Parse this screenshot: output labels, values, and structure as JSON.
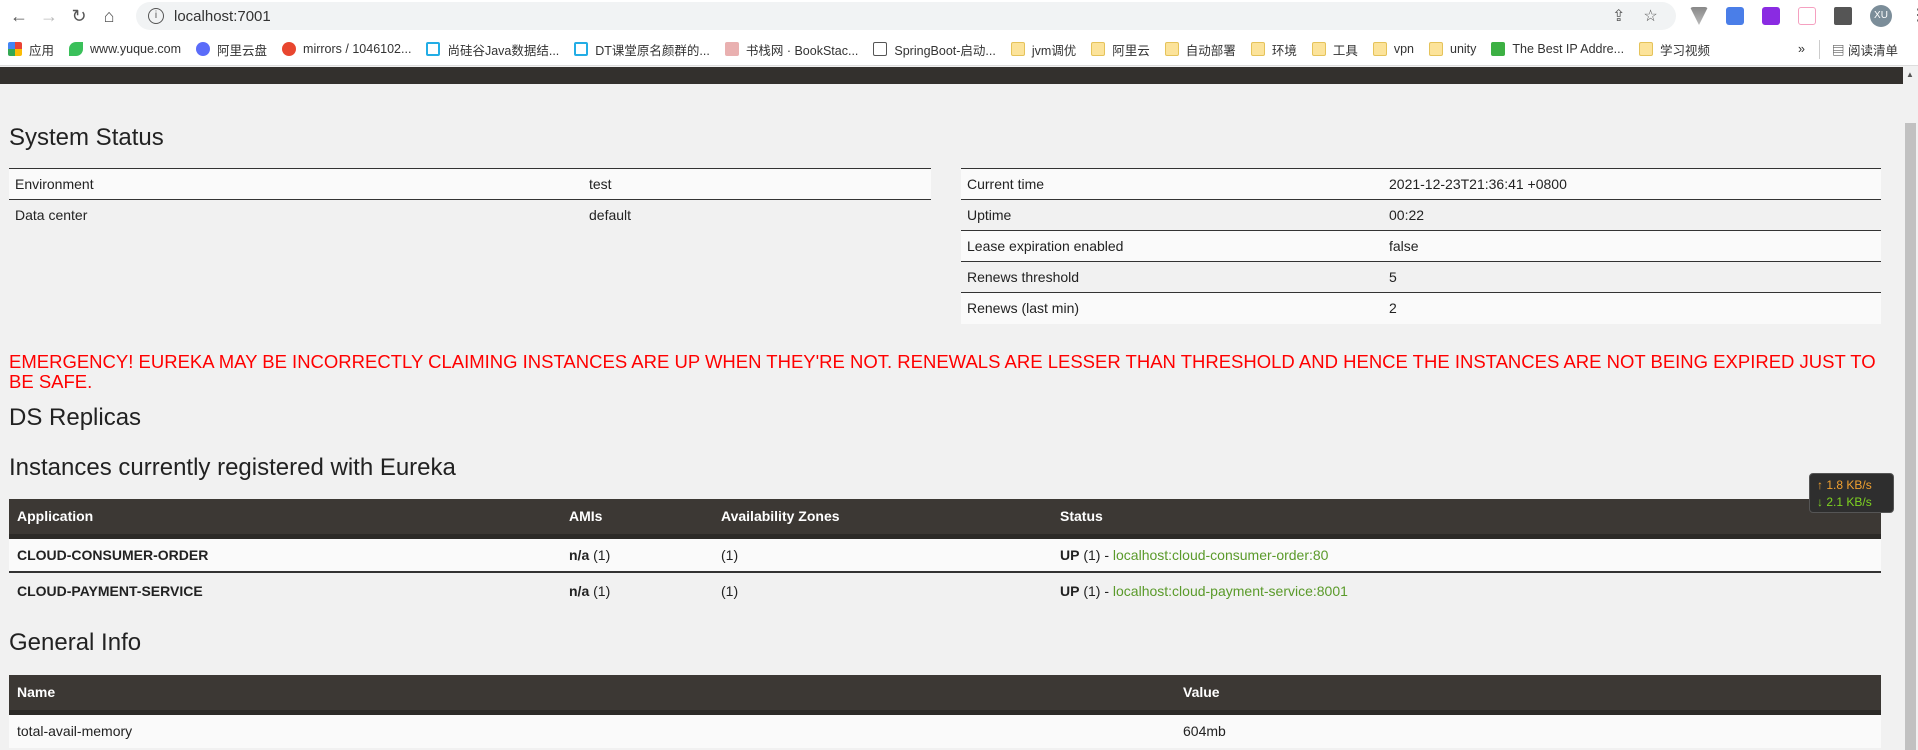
{
  "browser": {
    "url": "localhost:7001",
    "avatar": "XU",
    "bookmarks": [
      {
        "label": "应用",
        "icon": "apps-icon"
      },
      {
        "label": "www.yuque.com",
        "icon": "yuque-icon"
      },
      {
        "label": "阿里云盘",
        "icon": "aliyun-drive-icon"
      },
      {
        "label": "mirrors / 1046102...",
        "icon": "gitee-icon"
      },
      {
        "label": "尚硅谷Java数据结...",
        "icon": "bilibili-icon"
      },
      {
        "label": "DT课堂原名颜群的...",
        "icon": "bilibili-icon"
      },
      {
        "label": "书栈网 · BookStac...",
        "icon": "bookstack-icon"
      },
      {
        "label": "SpringBoot-启动...",
        "icon": "page-icon"
      },
      {
        "label": "jvm调优",
        "icon": "folder-icon"
      },
      {
        "label": "阿里云",
        "icon": "folder-icon"
      },
      {
        "label": "自动部署",
        "icon": "folder-icon"
      },
      {
        "label": "环境",
        "icon": "folder-icon"
      },
      {
        "label": "工具",
        "icon": "folder-icon"
      },
      {
        "label": "vpn",
        "icon": "folder-icon"
      },
      {
        "label": "unity",
        "icon": "folder-icon"
      },
      {
        "label": "The Best IP Addre...",
        "icon": "ip-icon"
      },
      {
        "label": "学习视频",
        "icon": "folder-icon"
      }
    ],
    "more": "»",
    "reading_list": "阅读清单"
  },
  "system_status": {
    "title": "System Status",
    "left": [
      {
        "key": "Environment",
        "value": "test"
      },
      {
        "key": "Data center",
        "value": "default"
      }
    ],
    "right": [
      {
        "key": "Current time",
        "value": "2021-12-23T21:36:41 +0800"
      },
      {
        "key": "Uptime",
        "value": "00:22"
      },
      {
        "key": "Lease expiration enabled",
        "value": "false"
      },
      {
        "key": "Renews threshold",
        "value": "5"
      },
      {
        "key": "Renews (last min)",
        "value": "2"
      }
    ]
  },
  "emergency": "EMERGENCY! EUREKA MAY BE INCORRECTLY CLAIMING INSTANCES ARE UP WHEN THEY'RE NOT. RENEWALS ARE LESSER THAN THRESHOLD AND HENCE THE INSTANCES ARE NOT BEING EXPIRED JUST TO BE SAFE.",
  "ds_replicas_title": "DS Replicas",
  "instances": {
    "title": "Instances currently registered with Eureka",
    "headers": [
      "Application",
      "AMIs",
      "Availability Zones",
      "Status"
    ],
    "rows": [
      {
        "app": "CLOUD-CONSUMER-ORDER",
        "ami": "n/a",
        "ami_count": "(1)",
        "zones": "(1)",
        "status": "UP",
        "status_count": "(1) -",
        "link": "localhost:cloud-consumer-order:80"
      },
      {
        "app": "CLOUD-PAYMENT-SERVICE",
        "ami": "n/a",
        "ami_count": "(1)",
        "zones": "(1)",
        "status": "UP",
        "status_count": "(1) -",
        "link": "localhost:cloud-payment-service:8001"
      }
    ]
  },
  "general_info": {
    "title": "General Info",
    "headers": [
      "Name",
      "Value"
    ],
    "rows": [
      {
        "name": "total-avail-memory",
        "value": "604mb"
      }
    ]
  },
  "speed": {
    "up": "↑ 1.8 KB/s",
    "down": "↓ 2.1 KB/s",
    "up_color": "#f0a030",
    "down_color": "#7ed321"
  }
}
